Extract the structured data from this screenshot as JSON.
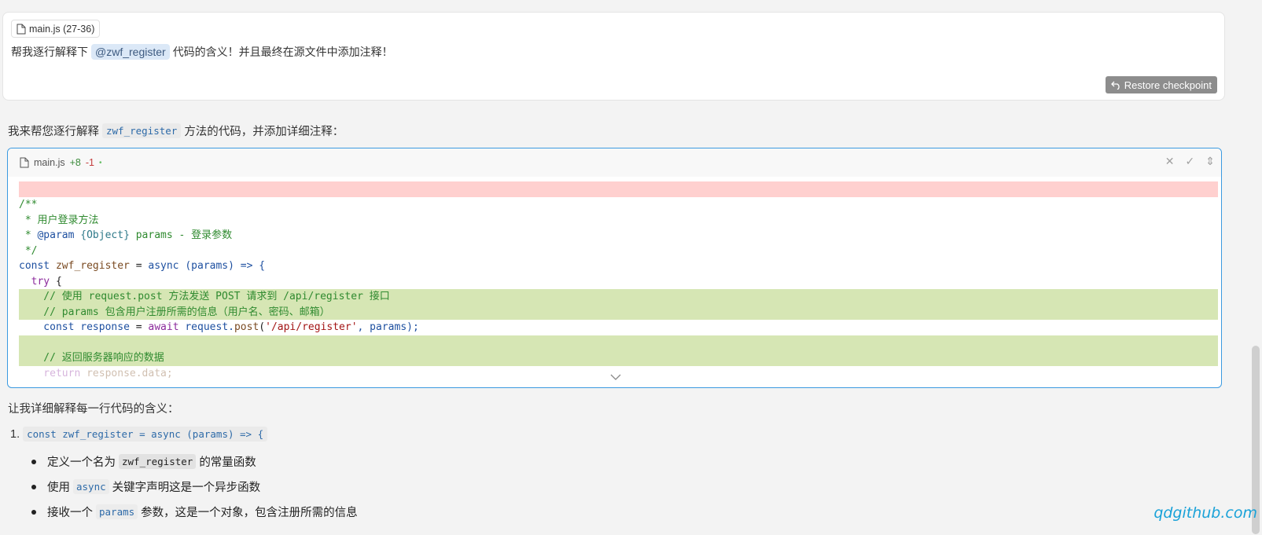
{
  "user_message": {
    "file_chip": "main.js (27-36)",
    "prefix": "帮我逐行解释下",
    "mention": "@zwf_register",
    "suffix": "代码的含义！并且最终在源文件中添加注释！",
    "restore_label": "Restore checkpoint"
  },
  "assistant": {
    "intro_prefix": "我来帮您逐行解释",
    "intro_code": "zwf_register",
    "intro_suffix": "方法的代码，并添加详细注释："
  },
  "code_block": {
    "filename": "main.js",
    "added": "+8",
    "removed": "-1",
    "dot": "•",
    "lines": {
      "l1": "/**",
      "l2": " * 用户登录方法",
      "l3_a": " * ",
      "l3_b": "@param",
      "l3_c": " {Object}",
      "l3_d": " params - 登录参数",
      "l4": " */",
      "l5_a": "const",
      "l5_b": " zwf_register",
      "l5_c": " = ",
      "l5_d": "async",
      "l5_e": " (params) => {",
      "l6_a": "  try",
      "l6_b": " {",
      "l7": "    // 使用 request.post 方法发送 POST 请求到 /api/register 接口",
      "l8": "    // params 包含用户注册所需的信息（用户名、密码、邮箱）",
      "l9_a": "    const",
      "l9_b": " response",
      "l9_c": " = ",
      "l9_d": "await",
      "l9_e": " request.",
      "l9_f": "post",
      "l9_g": "(",
      "l9_h": "'/api/register'",
      "l9_i": ", params);",
      "l11": "    // 返回服务器响应的数据",
      "l12_a": "    return",
      "l12_b": " response.data;"
    }
  },
  "explanation": {
    "title": "让我详细解释每一行代码的含义：",
    "item1_num": "1.",
    "item1_code": "const zwf_register = async (params) => {",
    "b1_prefix": "定义一个名为",
    "b1_code": "zwf_register",
    "b1_suffix": "的常量函数",
    "b2_prefix": "使用",
    "b2_code": "async",
    "b2_suffix": "关键字声明这是一个异步函数",
    "b3_prefix": "接收一个",
    "b3_code": "params",
    "b3_suffix": "参数，这是一个对象，包含注册所需的信息"
  },
  "watermark": "qdgithub.com"
}
